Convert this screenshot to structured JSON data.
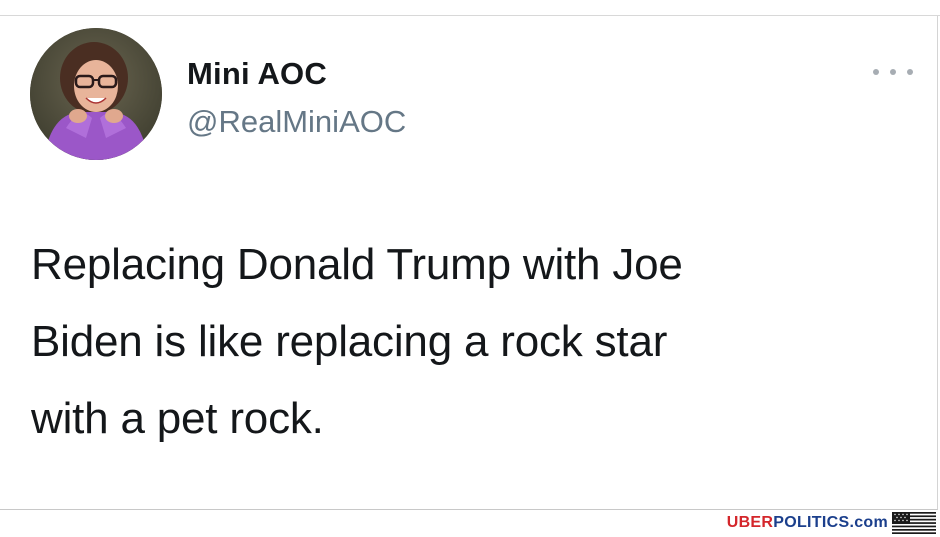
{
  "tweet": {
    "display_name": "Mini AOC",
    "handle": "@RealMiniAOC",
    "text_lines": [
      "Replacing Donald Trump with Joe",
      "Biden is like replacing a rock star",
      "with a pet rock."
    ],
    "avatar_icon": "user-avatar-photo",
    "more_icon": "more-options-icon"
  },
  "watermark": {
    "part1": "UBER",
    "part2": "POLITICS",
    "part3": ".com",
    "flag_icon": "us-flag-icon",
    "colors": {
      "red": "#d4262b",
      "blue": "#1b3f8c"
    }
  },
  "colors": {
    "name": "#14171a",
    "handle": "#657786",
    "text": "#14171a"
  }
}
